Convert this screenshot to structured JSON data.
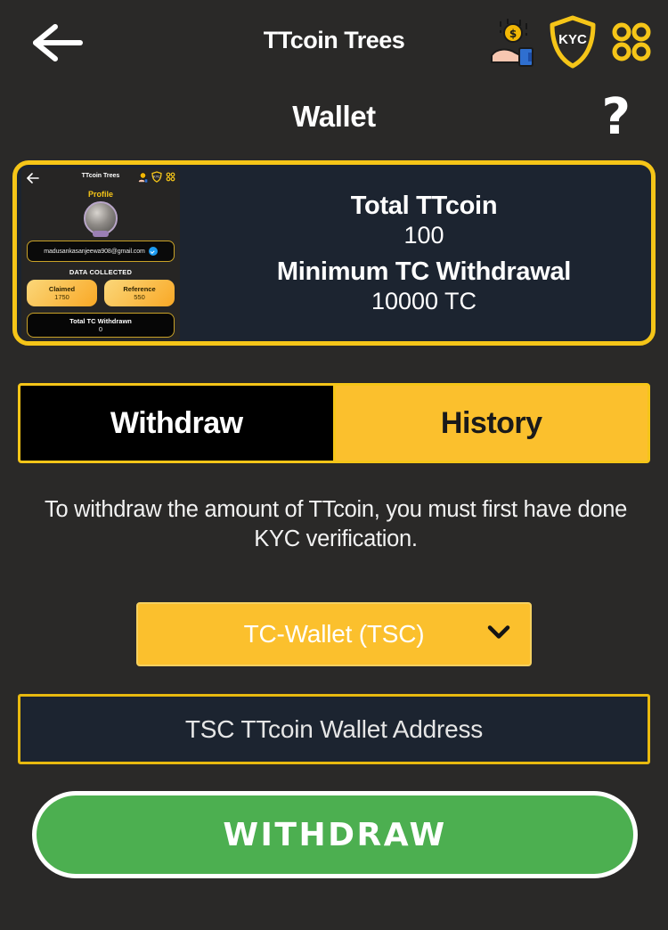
{
  "app": {
    "title": "TTcoin Trees",
    "page_title": "Wallet",
    "background_color": "#2a2928",
    "accent_color": "#f5c518"
  },
  "topbar": {
    "back_icon": "back-arrow-icon",
    "icons": [
      {
        "name": "coin-in-hand-icon",
        "label": ""
      },
      {
        "name": "kyc-shield-icon",
        "label": "KYC"
      },
      {
        "name": "grid-menu-icon",
        "label": ""
      }
    ],
    "help_label": "?"
  },
  "wallet_card": {
    "total_label": "Total TTcoin",
    "total_value": "100",
    "minimum_label": "Minimum TC Withdrawal",
    "minimum_value": "10000 TC",
    "thumbnail": {
      "app_title": "TTcoin Trees",
      "profile_label": "Profile",
      "email": "madusankasanjeewa908@gmail.com",
      "data_collected_label": "DATA COLLECTED",
      "chips": [
        {
          "label": "Claimed",
          "value": "1750"
        },
        {
          "label": "Reference",
          "value": "550"
        }
      ],
      "total_withdrawn_label": "Total TC Withdrawn",
      "total_withdrawn_value": "0"
    }
  },
  "tabs": [
    {
      "label": "Withdraw",
      "active": true
    },
    {
      "label": "History",
      "active": false
    }
  ],
  "notice": "To withdraw the amount of TTcoin, you must first have done KYC verification.",
  "form": {
    "wallet_select_value": "TC-Wallet (TSC)",
    "wallet_select_options": [
      "TC-Wallet (TSC)"
    ],
    "address_placeholder": "TSC TTcoin Wallet Address",
    "address_value": "",
    "submit_label": "WITHDRAW",
    "submit_color": "#4caf50"
  }
}
